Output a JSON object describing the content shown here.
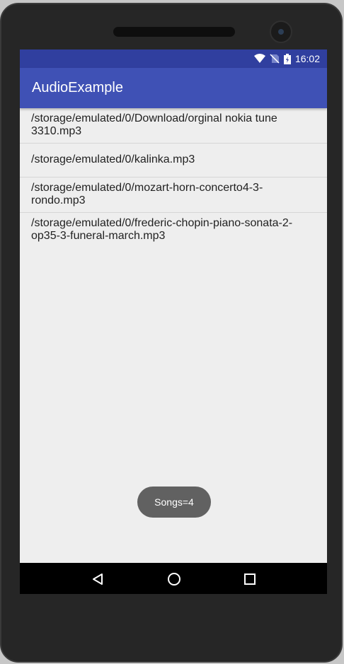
{
  "status_bar": {
    "time": "16:02",
    "icons": [
      "wifi-icon",
      "no-sim-icon",
      "battery-charging-icon"
    ]
  },
  "app_bar": {
    "title": "AudioExample"
  },
  "songs": [
    "/storage/emulated/0/Download/orginal nokia tune 3310.mp3",
    "/storage/emulated/0/kalinka.mp3",
    "/storage/emulated/0/mozart-horn-concerto4-3-rondo.mp3",
    "/storage/emulated/0/frederic-chopin-piano-sonata-2-op35-3-funeral-march.mp3"
  ],
  "toast": {
    "text": "Songs=4"
  },
  "nav_bar": {
    "icons": [
      "back-icon",
      "home-icon",
      "recents-icon"
    ]
  },
  "colors": {
    "primary": "#3f51b5",
    "primary_dark": "#303f9f",
    "background": "#eeeeee",
    "toast": "#616161"
  }
}
